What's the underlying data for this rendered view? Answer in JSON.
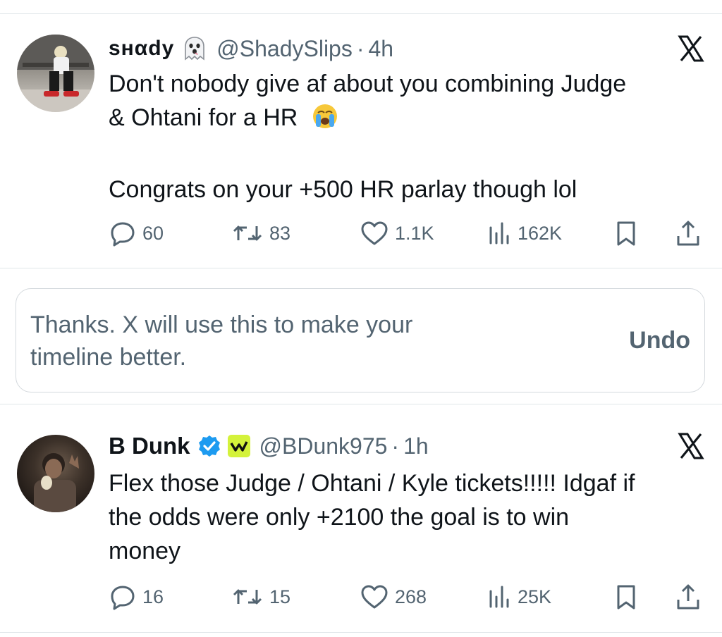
{
  "tweets": [
    {
      "display_name": "ѕнαdу",
      "handle": "@ShadySlips",
      "time_sep": "·",
      "time": "4h",
      "emoji": "ghost-emoji",
      "text_lines": [
        "Don't nobody give af about you combining Judge",
        "& Ohtani for a HR"
      ],
      "text_emoji": "loudly-crying-face-emoji",
      "text_line3": "Congrats on your +500 HR parlay though lol",
      "replies": "60",
      "reposts": "83",
      "likes": "1.1K",
      "views": "162K"
    },
    {
      "display_name": "B Dunk",
      "handle": "@BDunk975",
      "time_sep": "·",
      "time": "1h",
      "verified": true,
      "badge_color": "#d4f23b",
      "text_lines": [
        "Flex those Judge / Ohtani / Kyle tickets!!!!! Idgaf if",
        "the odds were only +2100 the goal is to win",
        "money"
      ],
      "replies": "16",
      "reposts": "15",
      "likes": "268",
      "views": "25K"
    }
  ],
  "feedback_notice": {
    "line1": "Thanks. X will use this to make your",
    "line2": "timeline better.",
    "undo_label": "Undo"
  },
  "colors": {
    "text": "#0f1419",
    "secondary": "#536471",
    "verified_blue": "#1d9bf0",
    "divider": "#e1e6ea"
  }
}
